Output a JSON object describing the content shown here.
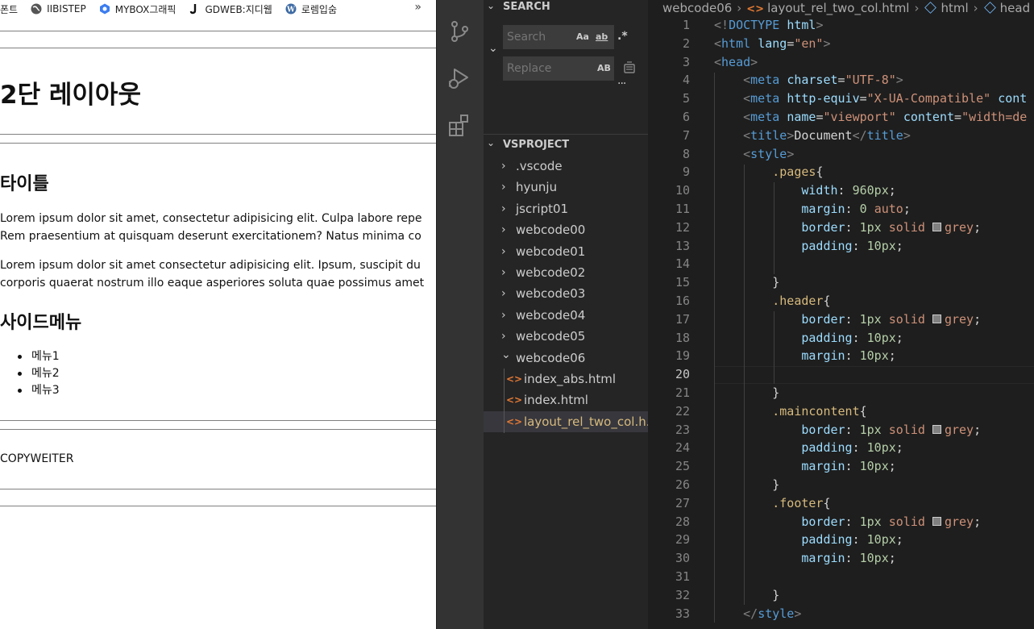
{
  "browser": {
    "bookmarks": [
      {
        "label": "폰트",
        "icon": "page-icon"
      },
      {
        "label": "IIBISTEP",
        "icon": "globe-icon"
      },
      {
        "label": "MYBOX그래픽",
        "icon": "mybox-icon"
      },
      {
        "label": "GDWEB:지디웹",
        "icon": "gdweb-icon"
      },
      {
        "label": "로렘입숨",
        "icon": "wordpress-icon"
      }
    ],
    "more": "»",
    "heading": "2단 레이아웃",
    "title": "타이틀",
    "para1_line1": "Lorem ipsum dolor sit amet, consectetur adipisicing elit. Culpa labore repe",
    "para1_line2": "Rem praesentium at quisquam deserunt exercitationem? Natus minima co",
    "para2_line1": "Lorem ipsum dolor sit amet consectetur adipisicing elit. Ipsum, suscipit du",
    "para2_line2": "corporis quaerat nostrum illo eaque asperiores soluta quae possimus amet",
    "side_title": "사이드메뉴",
    "menu": [
      "메뉴1",
      "메뉴2",
      "메뉴3"
    ],
    "footer": "COPYWEITER"
  },
  "sidebar": {
    "search_title": "SEARCH",
    "search_placeholder": "Search",
    "replace_placeholder": "Replace",
    "opt_case": "Aa",
    "opt_word": "ab",
    "opt_regex": ".*",
    "opt_preserve": "AB",
    "more": "···",
    "project_title": "VSPROJECT",
    "folders": [
      ".vscode",
      "hyunju",
      "jscript01",
      "webcode00",
      "webcode01",
      "webcode02",
      "webcode03",
      "webcode04",
      "webcode05",
      "webcode06"
    ],
    "files": [
      "index_abs.html",
      "index.html",
      "layout_rel_two_col.h..."
    ]
  },
  "editor": {
    "breadcrumb": {
      "folder": "webcode06",
      "file": "layout_rel_two_col.html",
      "node1": "html",
      "node2": "head"
    },
    "line_numbers": [
      "1",
      "2",
      "3",
      "4",
      "5",
      "6",
      "7",
      "8",
      "9",
      "10",
      "11",
      "12",
      "13",
      "14",
      "15",
      "16",
      "17",
      "18",
      "19",
      "20",
      "21",
      "22",
      "23",
      "24",
      "25",
      "26",
      "27",
      "28",
      "29",
      "30",
      "31",
      "32",
      "33"
    ],
    "active_line": "20",
    "colors": {
      "background": "#1e1e1e",
      "sidebar": "#252526",
      "activity": "#333333",
      "html_icon": "#e37933"
    }
  }
}
